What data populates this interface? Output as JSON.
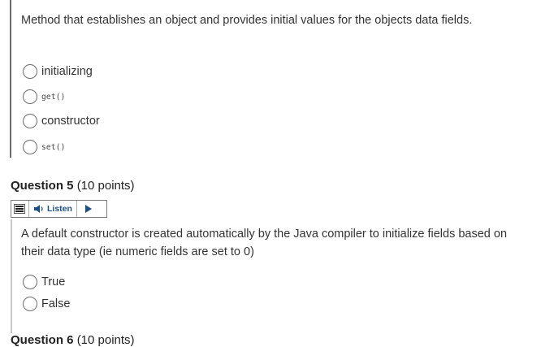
{
  "question4": {
    "prompt": "Method that establishes an object and provides initial values for the objects data fields.",
    "options": [
      {
        "label": "initializing",
        "style": "text"
      },
      {
        "label": "get()",
        "style": "code"
      },
      {
        "label": "constructor",
        "style": "text"
      },
      {
        "label": "set()",
        "style": "code"
      }
    ]
  },
  "question5": {
    "title": "Question 5",
    "points": "(10 points)",
    "listen_label": "Listen",
    "prompt": "A default constructor is created automatically by the Java compiler to initialize fields based on their data type (ie numeric fields are set to 0)",
    "options": [
      {
        "label": "True"
      },
      {
        "label": "False"
      }
    ]
  },
  "question6": {
    "title": "Question 6",
    "points": "(10 points)"
  },
  "colors": {
    "listen_accent": "#1a4f8b",
    "radio_border": "#6e6e6e",
    "text": "#333333"
  },
  "icons": {
    "menu": "hamburger-menu-icon",
    "speaker": "speaker-icon",
    "play": "play-icon"
  }
}
